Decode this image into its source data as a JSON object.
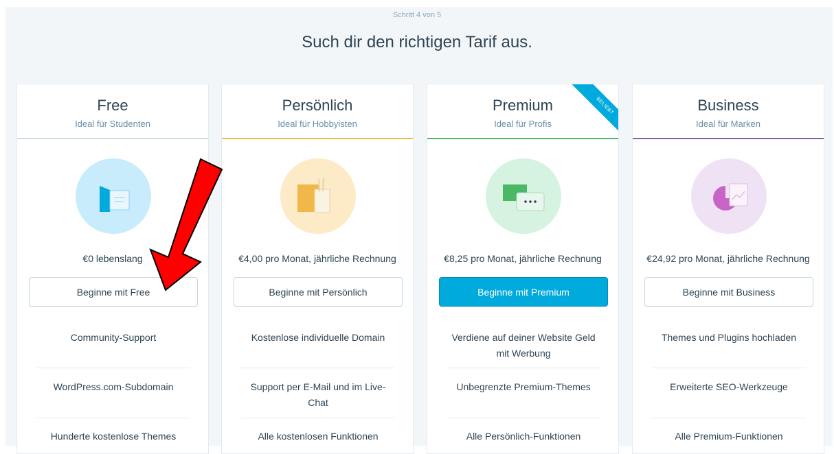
{
  "header": {
    "step": "Schritt 4 von 5",
    "title": "Such dir den richtigen Tarif aus."
  },
  "plans": [
    {
      "name": "Free",
      "subtitle": "Ideal für Studenten",
      "price": "€0 lebenslang",
      "cta": "Beginne mit Free",
      "accent": "#c8dbe8",
      "features": [
        "Community-Support",
        "WordPress.com-Subdomain",
        "Hunderte kostenlose Themes"
      ]
    },
    {
      "name": "Persönlich",
      "subtitle": "Ideal für Hobbyisten",
      "price": "€4,00 pro Monat, jährliche Rechnung",
      "cta": "Beginne mit Persönlich",
      "accent": "#f0b849",
      "features": [
        "Kostenlose individuelle Domain",
        "Support per E-Mail und im Live-Chat",
        "Alle kostenlosen Funktionen"
      ]
    },
    {
      "name": "Premium",
      "subtitle": "Ideal für Profis",
      "price": "€8,25 pro Monat, jährliche Rechnung",
      "cta": "Beginne mit Premium",
      "accent": "#4ab866",
      "ribbon": "BELIEBT",
      "features": [
        "Verdiene auf deiner Website Geld mit Werbung",
        "Unbegrenzte Premium-Themes",
        "Alle Persönlich-Funktionen"
      ]
    },
    {
      "name": "Business",
      "subtitle": "Ideal für Marken",
      "price": "€24,92 pro Monat, jährliche Rechnung",
      "cta": "Beginne mit Business",
      "accent": "#855da6",
      "features": [
        "Themes und Plugins hochladen",
        "Erweiterte SEO-Werkzeuge",
        "Alle Premium-Funktionen"
      ]
    }
  ],
  "colors": {
    "primary_button": "#00aadc",
    "annotation_arrow": "#ff0000"
  }
}
